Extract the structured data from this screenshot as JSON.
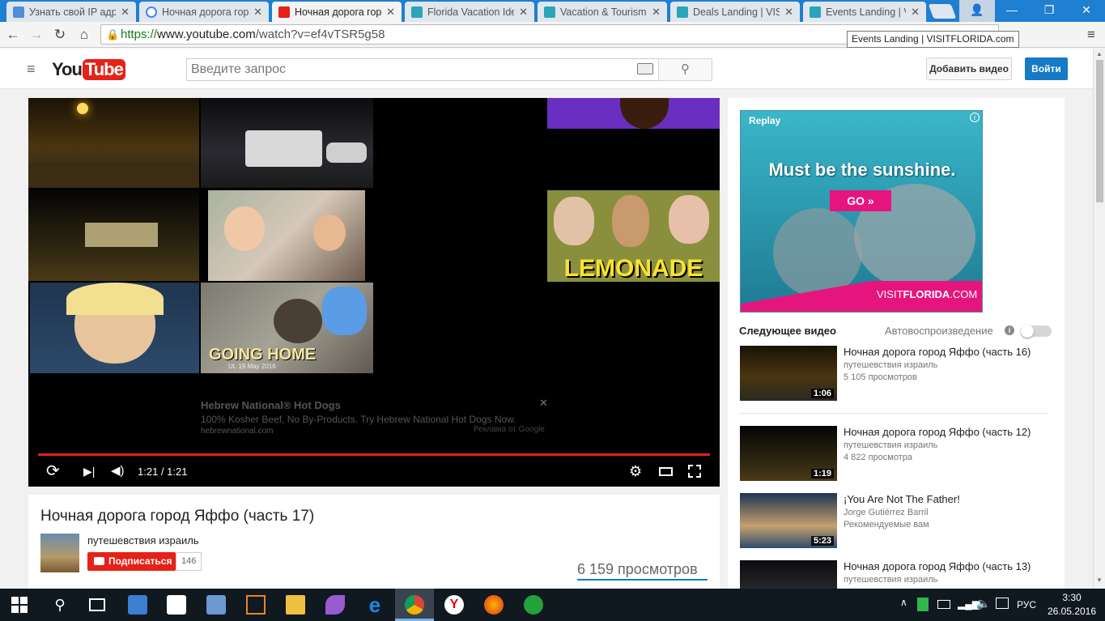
{
  "tabs": [
    {
      "title": "Узнать свой IP адре",
      "fav_color": "#4f8fd6"
    },
    {
      "title": "Ночная дорога гор",
      "fav_color": "#4285f4"
    },
    {
      "title": "Ночная дорога гор",
      "fav_color": "#e62117"
    },
    {
      "title": "Florida Vacation Ide",
      "fav_color": "#2aa6b8"
    },
    {
      "title": "Vacation & Tourism",
      "fav_color": "#2aa6b8"
    },
    {
      "title": "Deals Landing | VIS",
      "fav_color": "#2aa6b8"
    },
    {
      "title": "Events Landing | VIS",
      "fav_color": "#2aa6b8"
    }
  ],
  "address": {
    "scheme": "https://",
    "host": "www.youtube.com",
    "path": "/watch?v=ef4vTSR5g58"
  },
  "tooltip": "Events Landing | VISITFLORIDA.com",
  "youtube": {
    "logo_you": "You",
    "logo_tube": "Tube",
    "search_placeholder": "Введите запрос",
    "upload_label": "Добавить видео",
    "signin_label": "Войти"
  },
  "player": {
    "time": "1:21 / 1:21",
    "tile_going_home": "GOING HOME",
    "tile_going_home_sub": "Ut. 19 May 2016",
    "tile_lemonade": "LEMONADE",
    "ad_title": "Hebrew National® Hot Dogs",
    "ad_text": "100% Kosher Beef, No By-Products. Try Hebrew National Hot Dogs Now.",
    "ad_url": "hebrewnational.com",
    "ad_label": "Реклама от Google",
    "ad_close": "✕",
    "progress": 1.0
  },
  "video": {
    "title": "Ночная дорога город Яффо (часть 17)",
    "channel": "путешевствия израиль",
    "subscribe_label": "Подписаться",
    "subscribers": "146",
    "views": "6 159 просмотров"
  },
  "ad_banner": {
    "replay": "Replay",
    "headline": "Must be the sunshine.",
    "button": "GO »",
    "brand_a": "VISIT",
    "brand_b": "FLORIDA",
    "brand_c": ".COM"
  },
  "up_next": {
    "heading": "Следующее видео",
    "autoplay_label": "Автовоспроизведение",
    "items": [
      {
        "title": "Ночная дорога город Яффо (часть 16)",
        "channel": "путешевствия израиль",
        "views": "5 105 просмотров",
        "duration": "1:06"
      },
      {
        "title": "Ночная дорога город Яффо (часть 12)",
        "channel": "путешевствия израиль",
        "views": "4 822 просмотра",
        "duration": "1:19"
      },
      {
        "title": "¡You Are Not The Father!",
        "channel": "Jorge Gutiérrez Barril",
        "views": "Рекомендуемые вам",
        "duration": "5:23"
      },
      {
        "title": "Ночная дорога город Яффо (часть 13)",
        "channel": "путешевствия израиль",
        "views": "",
        "duration": ""
      }
    ]
  },
  "taskbar": {
    "lang": "РУС",
    "time": "3:30",
    "date": "26.05.2016"
  }
}
